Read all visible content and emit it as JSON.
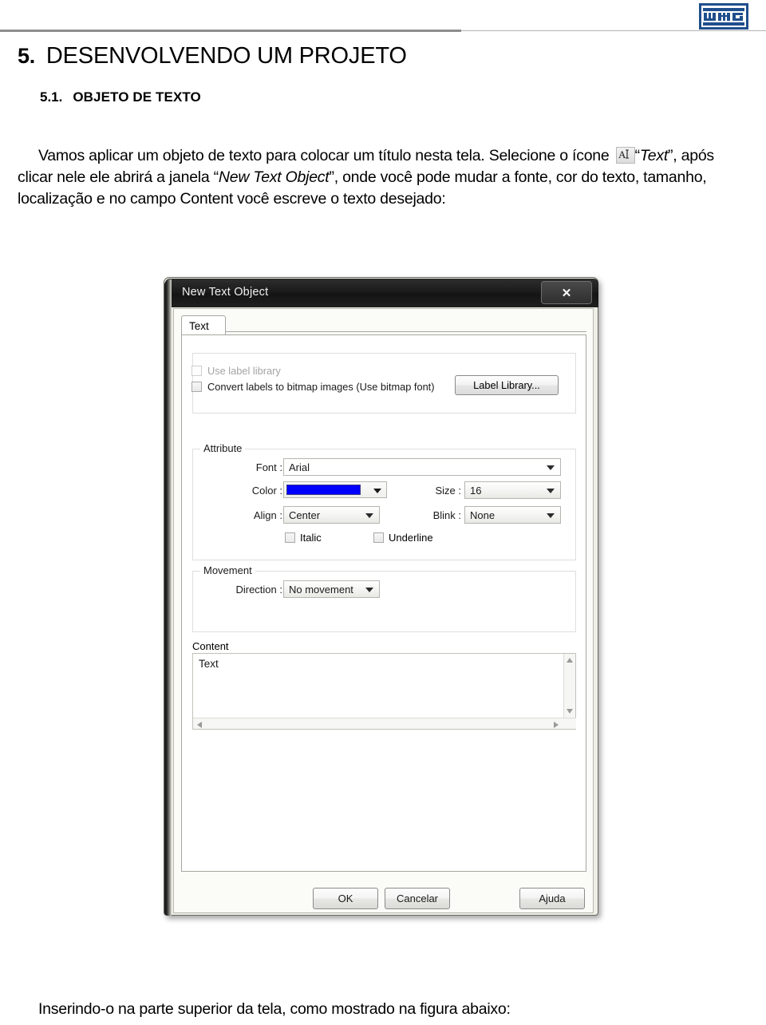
{
  "header": {
    "logo_text": "WEG",
    "logo_color": "#1f4e8c"
  },
  "document": {
    "section_number": "5.",
    "section_title": "DESENVOLVENDO UM PROJETO",
    "subsection_number": "5.1.",
    "subsection_title": "OBJETO DE TEXTO",
    "paragraph": {
      "part1": "Vamos aplicar um objeto de texto para colocar um título nesta tela. Selecione o ícone ",
      "icon_name": "text-tool-icon",
      "part2": "“",
      "em1": "Text",
      "part3": "”, após clicar nele ele abrirá a janela “",
      "em2": "New Text Object",
      "part4": "”, onde você pode mudar a fonte, cor do texto, tamanho, localização e no campo Content você escreve o texto desejado:"
    },
    "caption": "Inserindo-o na parte superior da tela, como mostrado na figura abaixo:"
  },
  "dialog": {
    "title": "New Text Object",
    "close_label": "✕",
    "tabs": [
      {
        "label": "Text",
        "selected": true
      }
    ],
    "label_library_group": {
      "use_label_library": {
        "label": "Use label library",
        "checked": false,
        "disabled": true
      },
      "convert_labels": {
        "label": "Convert labels to bitmap images (Use bitmap font)",
        "checked": false,
        "disabled": false
      },
      "button_label": "Label Library..."
    },
    "attribute_group": {
      "legend": "Attribute",
      "font": {
        "label": "Font :",
        "value": "Arial"
      },
      "color": {
        "label": "Color :",
        "value": "#0000FF"
      },
      "align": {
        "label": "Align :",
        "value": "Center"
      },
      "size": {
        "label": "Size :",
        "value": "16"
      },
      "blink": {
        "label": "Blink :",
        "value": "None"
      },
      "italic": {
        "label": "Italic",
        "checked": false
      },
      "underline": {
        "label": "Underline",
        "checked": false
      }
    },
    "movement_group": {
      "legend": "Movement",
      "direction": {
        "label": "Direction :",
        "value": "No movement"
      }
    },
    "content_group": {
      "legend": "Content",
      "value": "Text"
    },
    "buttons": {
      "ok": "OK",
      "cancel": "Cancelar",
      "help": "Ajuda"
    }
  }
}
